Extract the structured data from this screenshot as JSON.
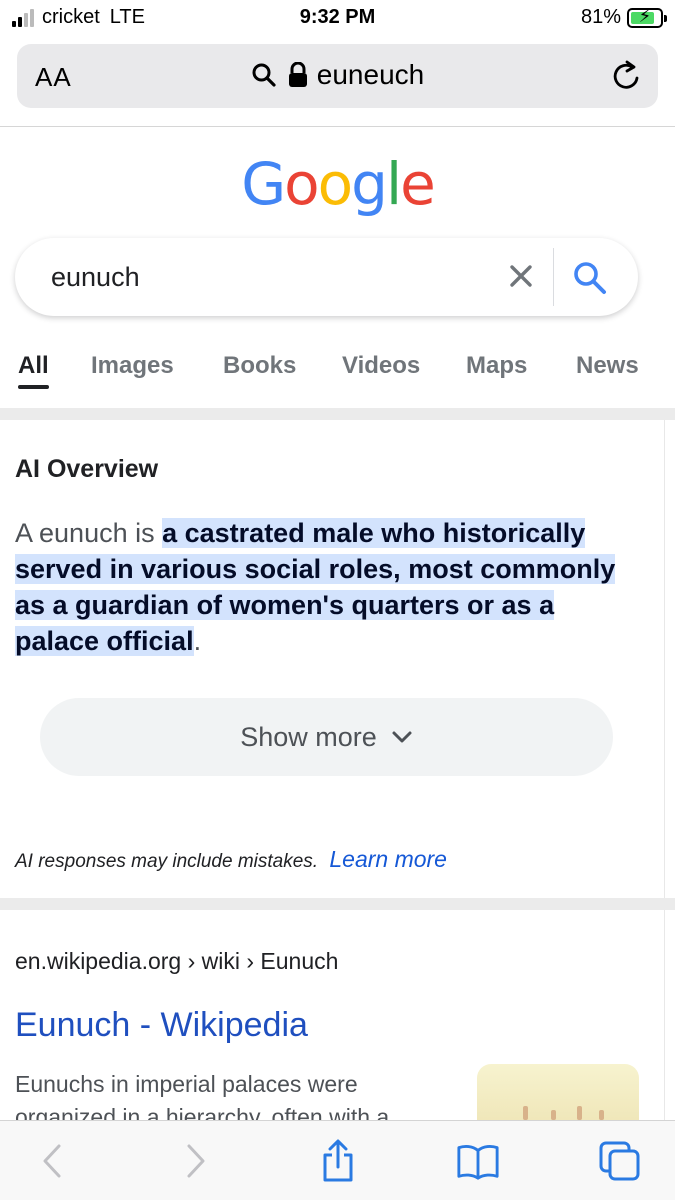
{
  "status_bar": {
    "carrier": "cricket",
    "network": "LTE",
    "time": "9:32 PM",
    "battery": "81%",
    "battery_level": 0.81,
    "charging": true
  },
  "address_bar": {
    "text_size_label": "AA",
    "url": "euneuch"
  },
  "logo": {
    "letters": [
      "G",
      "o",
      "o",
      "g",
      "l",
      "e"
    ]
  },
  "search": {
    "query": "eunuch"
  },
  "tabs": [
    {
      "label": "All",
      "active": true
    },
    {
      "label": "Images",
      "active": false
    },
    {
      "label": "Books",
      "active": false
    },
    {
      "label": "Videos",
      "active": false
    },
    {
      "label": "Maps",
      "active": false
    },
    {
      "label": "News",
      "active": false
    }
  ],
  "ai_overview": {
    "title": "AI Overview",
    "text_before": "A eunuch is ",
    "text_highlight": "a castrated male who historically served in various social roles, most commonly as a guardian of women's quarters or as a palace official",
    "text_after": ".",
    "show_more": "Show more",
    "disclaimer": "AI responses may include mistakes.",
    "learn_more": "Learn more"
  },
  "result": {
    "breadcrumb": "en.wikipedia.org › wiki › Eunuch",
    "title": "Eunuch - Wikipedia",
    "snippet": "Eunuchs in imperial palaces were organized in a hierarchy, often with a"
  },
  "colors": {
    "google_blue": "#4285f4",
    "google_red": "#ea4335",
    "google_yellow": "#fbbc05",
    "google_green": "#34a853",
    "highlight": "#d3e3fd",
    "link": "#1558d6"
  }
}
